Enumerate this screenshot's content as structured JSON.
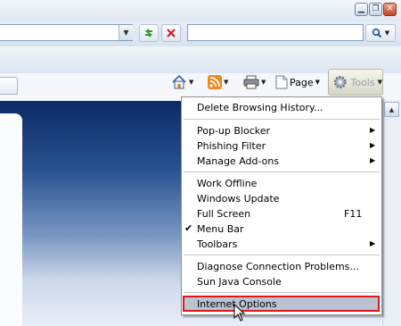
{
  "address_bar": {
    "value": "",
    "dropdown_icon": "chevron-down-icon"
  },
  "search_box": {
    "value": ""
  },
  "command_bar": {
    "page_label": "Page",
    "tools_label": "Tools"
  },
  "tools_menu": {
    "items": [
      {
        "label": "Delete Browsing History..."
      },
      {
        "label": "Pop-up Blocker",
        "submenu": true
      },
      {
        "label": "Phishing Filter",
        "submenu": true
      },
      {
        "label": "Manage Add-ons",
        "submenu": true
      },
      {
        "label": "Work Offline"
      },
      {
        "label": "Windows Update"
      },
      {
        "label": "Full Screen",
        "shortcut": "F11"
      },
      {
        "label": "Menu Bar",
        "checked": true
      },
      {
        "label": "Toolbars",
        "submenu": true
      },
      {
        "label": "Diagnose Connection Problems..."
      },
      {
        "label": "Sun Java Console"
      },
      {
        "label": "Internet Options",
        "highlighted": true
      }
    ]
  },
  "colors": {
    "highlight_border": "#e0141b",
    "highlight_fill": "#b9c3d2"
  }
}
